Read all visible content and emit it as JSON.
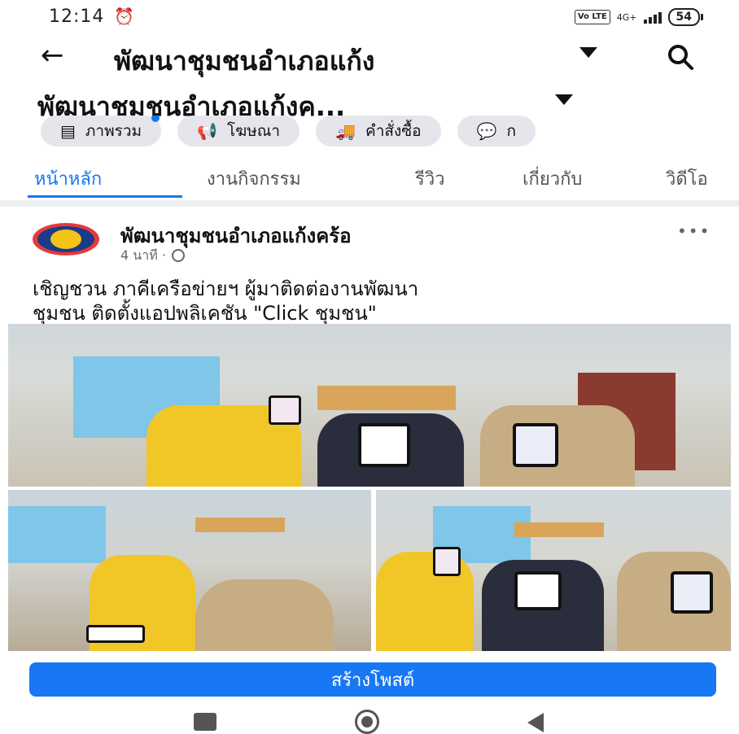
{
  "status_bar": {
    "time": "12:14",
    "alarm_icon": "alarm-clock-icon",
    "volte": "Vo LTE",
    "network": "4G+",
    "battery": "54"
  },
  "app_bar": {
    "back_icon": "back-arrow-icon",
    "title": "พัฒนาชุมชนอำเภอแก้ง",
    "dropdown_icon": "caret-down-icon",
    "search_icon": "search-icon"
  },
  "page_name": "พัฒนาชุมชนอำเภอแก้งค...",
  "chips": [
    {
      "label": "ภาพรวม",
      "icon": "overview-list-icon"
    },
    {
      "label": "โฆษณา",
      "icon": "megaphone-icon"
    },
    {
      "label": "คำสั่งซื้อ",
      "icon": "truck-icon"
    },
    {
      "label": "ก",
      "icon": "chat-bubbles-icon"
    }
  ],
  "tabs": [
    {
      "label": "หน้าหลัก",
      "active": true
    },
    {
      "label": "งานกิจกรรม",
      "active": false
    },
    {
      "label": "รีวิว",
      "active": false
    },
    {
      "label": "เกี่ยวกับ",
      "active": false
    },
    {
      "label": "วิดีโอ",
      "active": false
    }
  ],
  "post": {
    "author": "พัฒนาชุมชนอำเภอแก้งคร้อ",
    "time": "4 นาที ·",
    "privacy_icon": "globe-icon",
    "more_icon": "more-dots-icon",
    "text_line1": "เชิญชวน ภาคีเครือข่ายฯ ผู้มาติดต่องานพัฒนา",
    "text_line2": "ชุมชน ติดตั้งแอปพลิเคชัน \"Click ชุมชน\""
  },
  "create_post_button": "สร้างโพสต์",
  "nav_bar": {
    "recents_icon": "recents-square-icon",
    "home_icon": "home-circle-icon",
    "back_icon": "back-triangle-icon"
  },
  "colors": {
    "accent": "#1877f2",
    "chip_bg": "#e4e6eb",
    "text": "#1c1e21"
  }
}
